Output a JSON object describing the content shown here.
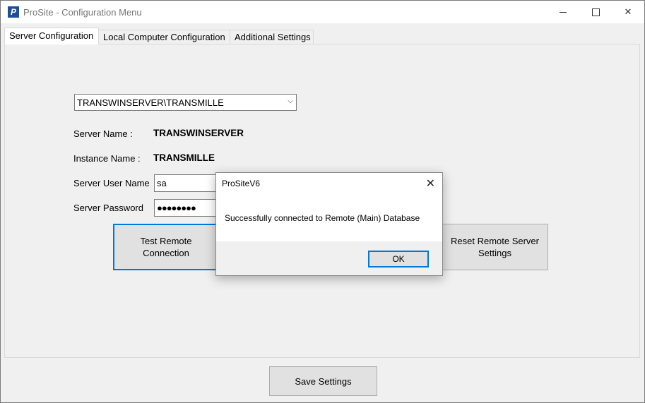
{
  "window": {
    "title": "ProSite - Configuration Menu",
    "app_icon_glyph": "P",
    "minimize_icon": "minimize-icon",
    "maximize_icon": "maximize-icon",
    "close_glyph": "✕"
  },
  "tabs": [
    {
      "label": "Server Configuration",
      "active": true
    },
    {
      "label": "Local Computer Configuration",
      "active": false
    },
    {
      "label": "Additional Settings",
      "active": false
    }
  ],
  "server": {
    "selected_instance": "TRANSWINSERVER\\TRANSMILLE",
    "server_name_label": "Server Name :",
    "server_name_value": "TRANSWINSERVER",
    "instance_name_label": "Instance Name :",
    "instance_name_value": "TRANSMILLE",
    "user_label": "Server User Name",
    "user_value": "sa",
    "password_label": "Server Password",
    "password_value": "●●●●●●●●",
    "test_button": "Test Remote Connection",
    "reset_button": "Reset Remote Server Settings"
  },
  "footer": {
    "save_button": "Save Settings"
  },
  "dialog": {
    "title": "ProSiteV6",
    "close_glyph": "✕",
    "message": "Successfully connected to Remote (Main) Database",
    "ok_button": "OK"
  },
  "colors": {
    "focus_accent": "#0078d7",
    "window_bg": "#f0f0f0"
  }
}
